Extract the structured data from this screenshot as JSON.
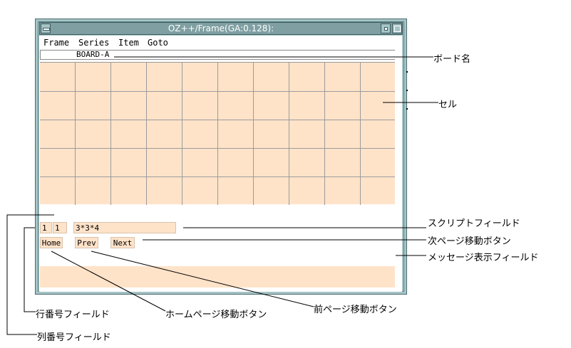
{
  "window": {
    "title": "OZ++/Frame(GA:0.128):"
  },
  "menu": {
    "items": [
      "Frame",
      "Series",
      "Item",
      "Goto"
    ]
  },
  "board": {
    "name": "BOARD-A"
  },
  "fields": {
    "row_number": "1",
    "column_number": "1",
    "script": "3*3*4",
    "message": ""
  },
  "buttons": {
    "home": "Home",
    "prev": "Prev",
    "next": "Next"
  },
  "annotations": {
    "board_name": "ボード名",
    "cell": "セル",
    "script_field": "スクリプトフィールド",
    "next_button": "次ページ移動ボタン",
    "message_field": "メッセージ表示フィールド",
    "prev_button": "前ページ移動ボタン",
    "row_field": "行番号フィールド",
    "home_button": "ホームページ移動ボタン",
    "column_field": "列番号フィールド"
  },
  "colors": {
    "frame": "#a6c3c5",
    "cell_fill": "#ffe3c9",
    "grid_line": "#9b9b9b"
  }
}
